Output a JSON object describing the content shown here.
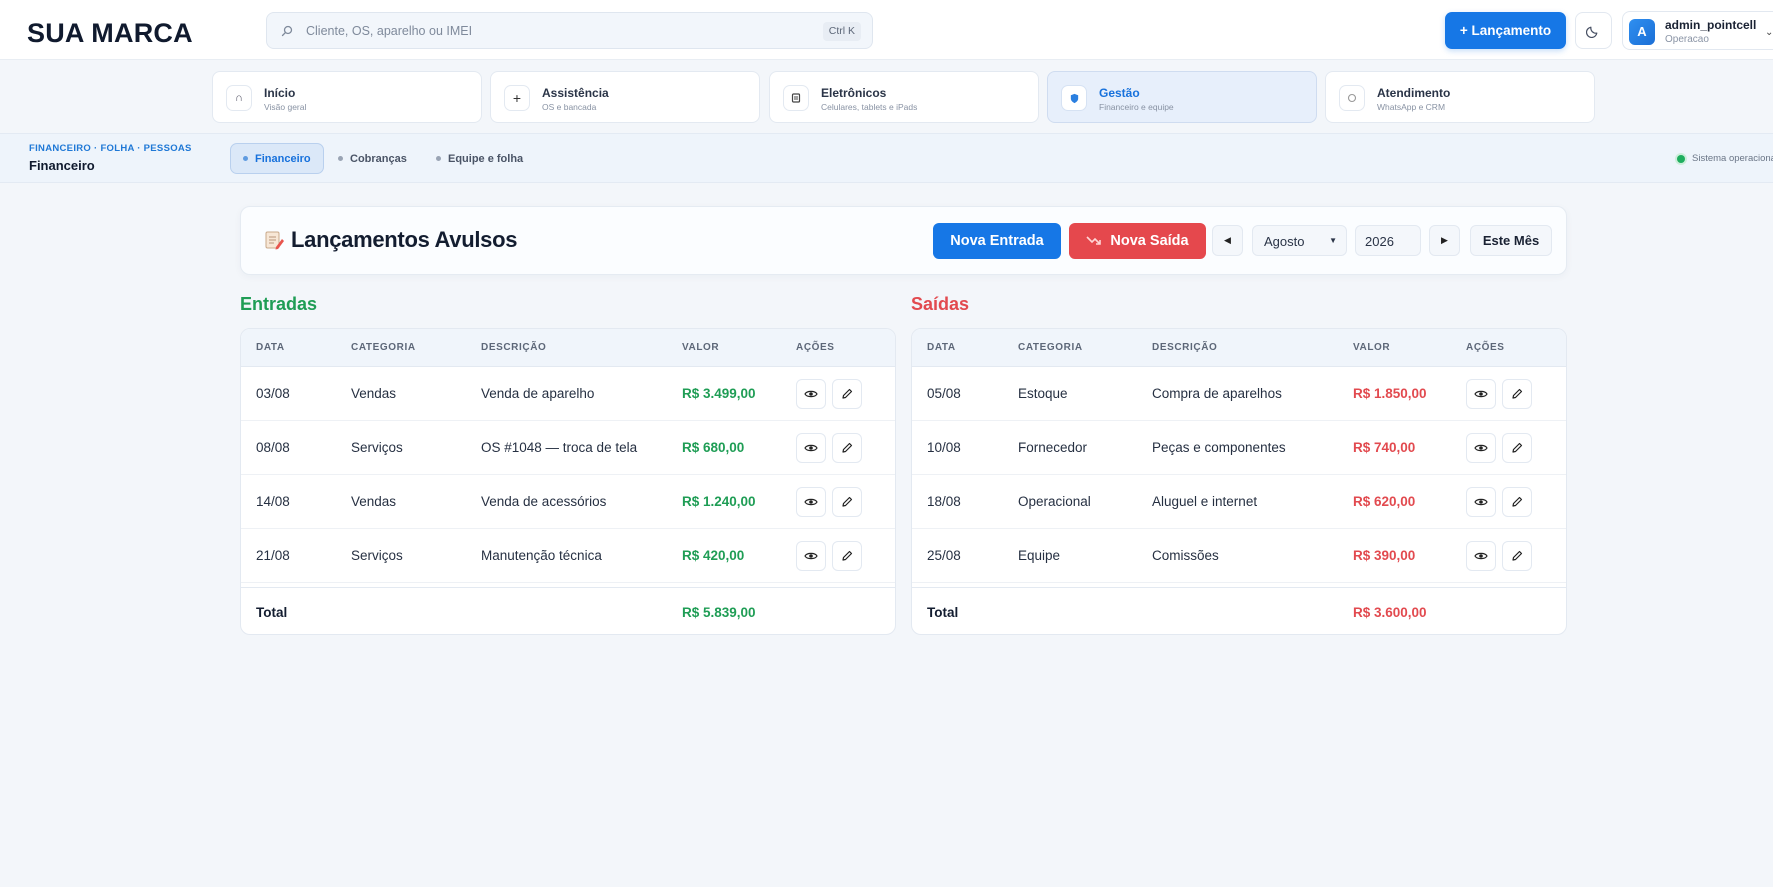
{
  "brand": "SUA MARCA",
  "search": {
    "placeholder": "Cliente, OS, aparelho ou IMEI",
    "shortcut": "Ctrl K"
  },
  "header": {
    "new_entry_label": "+ Lançamento"
  },
  "user": {
    "avatar_letter": "A",
    "name": "admin_pointcell",
    "role": "Operacao"
  },
  "modules": [
    {
      "title": "Início",
      "subtitle": "Visão geral",
      "icon": "home-icon"
    },
    {
      "title": "Assistência",
      "subtitle": "OS e bancada",
      "icon": "plus-icon"
    },
    {
      "title": "Eletrônicos",
      "subtitle": "Celulares, tablets e iPads",
      "icon": "device-icon"
    },
    {
      "title": "Gestão",
      "subtitle": "Financeiro e equipe",
      "icon": "shield-icon",
      "active": true
    },
    {
      "title": "Atendimento",
      "subtitle": "WhatsApp e CRM",
      "icon": "chat-icon"
    }
  ],
  "subbar": {
    "breadcrumb": "FINANCEIRO · FOLHA · PESSOAS",
    "title": "Financeiro",
    "tabs": [
      "Financeiro",
      "Cobranças",
      "Equipe e folha"
    ],
    "status": "Sistema operacional"
  },
  "lancamentos": {
    "title": "Lançamentos Avulsos",
    "new_in_label": "Nova Entrada",
    "new_out_label": "Nova Saída",
    "month": "Agosto",
    "year": "2026",
    "this_month_label": "Este Mês"
  },
  "columns": [
    "DATA",
    "CATEGORIA",
    "DESCRIÇÃO",
    "VALOR",
    "AÇÕES"
  ],
  "entradas": {
    "title": "Entradas",
    "rows": [
      {
        "date": "03/08",
        "category": "Vendas",
        "description": "Venda de aparelho",
        "value": "R$ 3.499,00"
      },
      {
        "date": "08/08",
        "category": "Serviços",
        "description": "OS #1048 — troca de tela",
        "value": "R$ 680,00"
      },
      {
        "date": "14/08",
        "category": "Vendas",
        "description": "Venda de acessórios",
        "value": "R$ 1.240,00"
      },
      {
        "date": "21/08",
        "category": "Serviços",
        "description": "Manutenção técnica",
        "value": "R$ 420,00"
      }
    ],
    "total_label": "Total",
    "total": "R$ 5.839,00"
  },
  "saidas": {
    "title": "Saídas",
    "rows": [
      {
        "date": "05/08",
        "category": "Estoque",
        "description": "Compra de aparelhos",
        "value": "R$ 1.850,00"
      },
      {
        "date": "10/08",
        "category": "Fornecedor",
        "description": "Peças e componentes",
        "value": "R$ 740,00"
      },
      {
        "date": "18/08",
        "category": "Operacional",
        "description": "Aluguel e internet",
        "value": "R$ 620,00"
      },
      {
        "date": "25/08",
        "category": "Equipe",
        "description": "Comissões",
        "value": "R$ 390,00"
      }
    ],
    "total_label": "Total",
    "total": "R$ 3.600,00"
  },
  "colors": {
    "primary": "#1677e6",
    "income": "#1f9d55",
    "expense": "#e24a4f",
    "status_ok": "#1fae5f"
  }
}
